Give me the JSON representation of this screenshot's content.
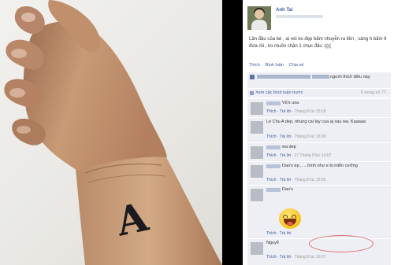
{
  "post": {
    "author": "Anh Tai",
    "text": "Lần đầu của bé , ai nói ko đẹp bấm nhuyễn ra liền , sáng h bấm 9 đứa rồi , ko muốn chặn 1 chục đâu :((((",
    "actions": {
      "like": "Thích",
      "comment": "Bình luận",
      "share": "Chia sẻ"
    },
    "likes_text": "người thích điều này.",
    "view_more": "Xem các bình luận trước",
    "comment_count": "6 trong số 77"
  },
  "comment_actions": {
    "like": "Thích",
    "reply": "Trả lời"
  },
  "comments": [
    {
      "text": "Vũ's uoa",
      "time": "Tháng 8 lúc 15:58"
    },
    {
      "text": "Le Chu A dep, nhung cai tay cua aj xau wa. Kaaaaa",
      "time": "Tháng 8 lúc 16:08"
    },
    {
      "text": "wa dep",
      "time": "17 Tháng 8 lúc 10:07"
    },
    {
      "text": "Dao's ep... ...hình như e bị miễn cưỡng",
      "time": "Tháng 8 lúc 16:02"
    },
    {
      "text": "Dao's",
      "time": ""
    },
    {
      "text": "Nguyễ",
      "time": "Tháng 8 lúc 19:27"
    }
  ],
  "tattoo_letter": "A",
  "colors": {
    "fb_blue": "#3b5998",
    "comment_bg": "#edeff4",
    "highlight_oval": "#e06a6a",
    "skin": "#c4936c"
  }
}
